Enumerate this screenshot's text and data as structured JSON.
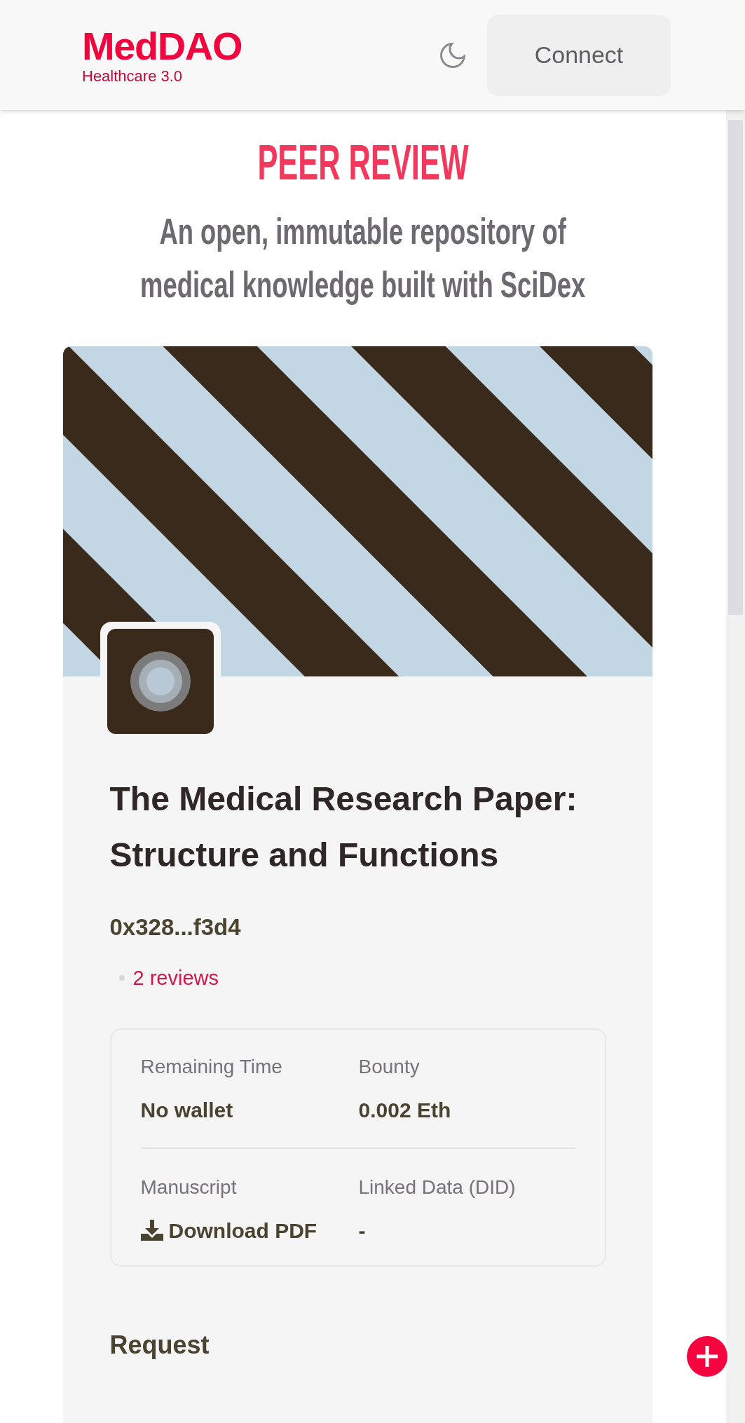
{
  "header": {
    "logo": {
      "name": "MedDAO",
      "tagline": "Healthcare 3.0"
    },
    "connect_button": "Connect"
  },
  "hero": {
    "title": "PEER REVIEW",
    "subtitle_lines": [
      "An open, immutable repository of",
      "medical knowledge built with SciDex"
    ]
  },
  "paper": {
    "title_lines": [
      "The Medical Research Paper:",
      "Structure and Functions"
    ],
    "author": "0x328...f3d4",
    "reviews": "2 reviews",
    "details": [
      {
        "label": "Remaining Time",
        "value": "No wallet",
        "kind": "text"
      },
      {
        "label": "Bounty",
        "value": "0.002 Eth",
        "kind": "text"
      },
      {
        "label": "Manuscript",
        "value": "Download PDF",
        "kind": "download"
      },
      {
        "label": "Linked Data (DID)",
        "value": "-",
        "kind": "text"
      }
    ],
    "section_heading": "Request"
  }
}
